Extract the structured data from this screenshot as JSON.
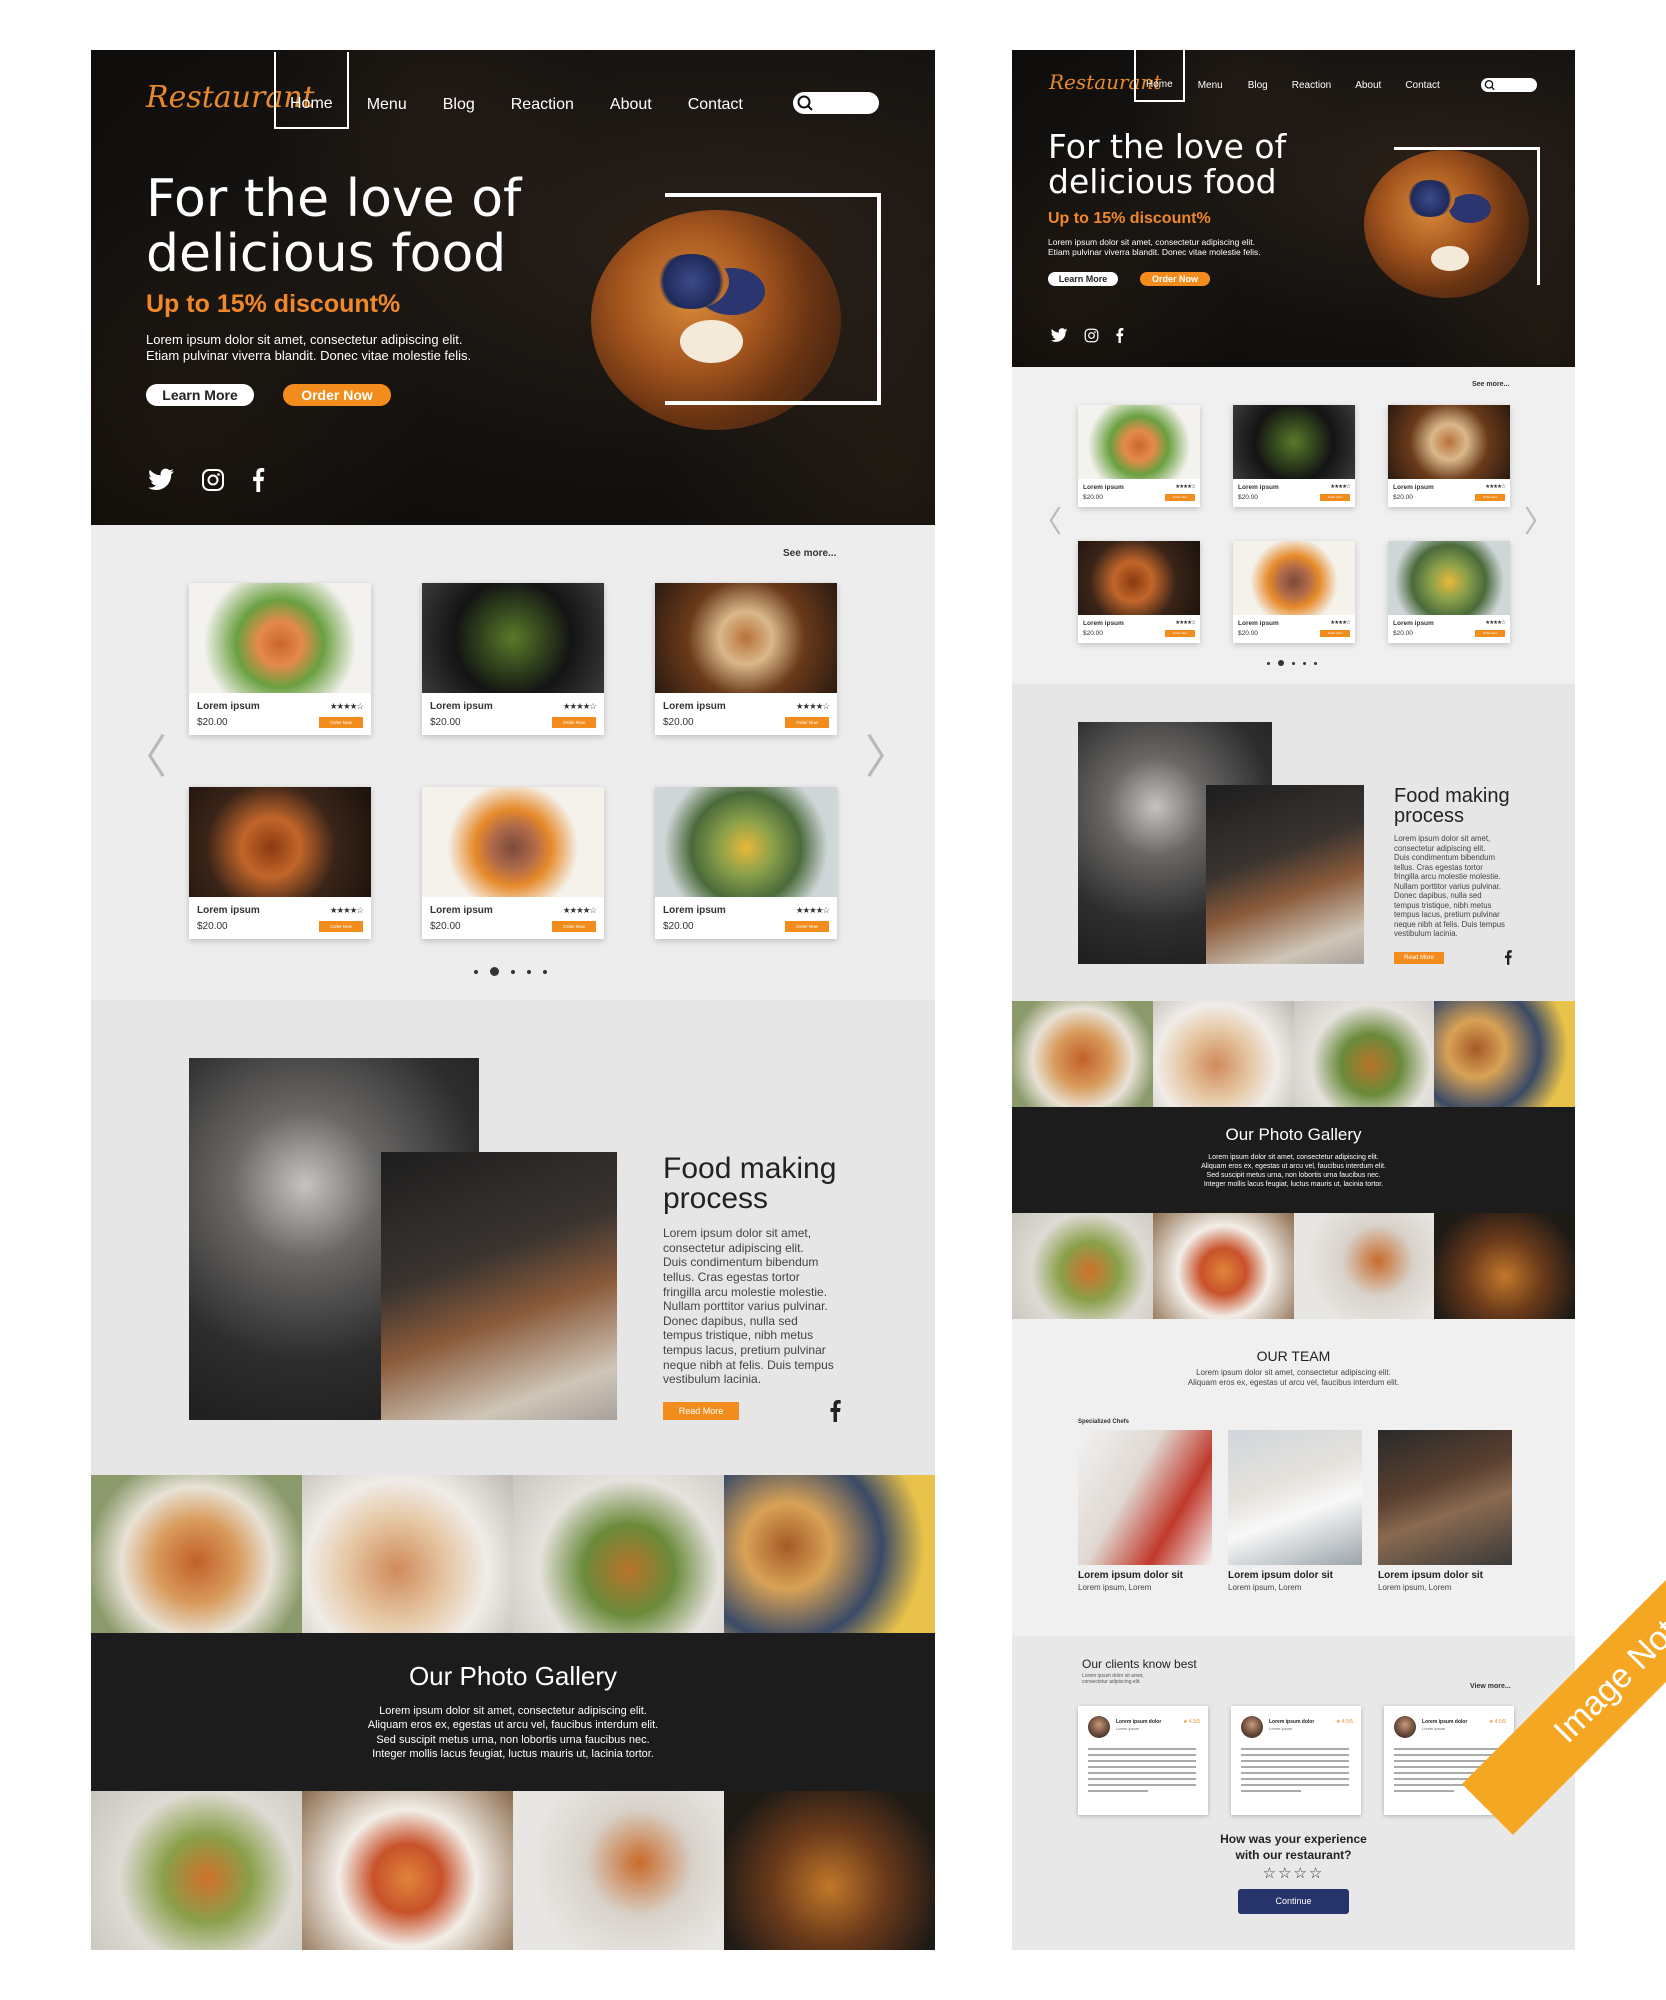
{
  "nav": {
    "logo": "Restaurant",
    "items": [
      "Home",
      "Menu",
      "Blog",
      "Reaction",
      "About",
      "Contact"
    ]
  },
  "hero": {
    "title": "For the love of\ndelicious food",
    "discount": "Up to 15% discount%",
    "text": "Lorem ipsum dolor sit amet, consectetur adipiscing elit.\nEtiam pulvinar viverra blandit. Donec vitae molestie felis.",
    "learn_more": "Learn More",
    "order_now": "Order Now"
  },
  "menu": {
    "see_more": "See more...",
    "card_name": "Lorem ipsum",
    "card_price": "$20.00",
    "card_stars": "★★★★☆",
    "card_btn": "Order Now",
    "cards": [
      {
        "photo": "salmon-salad"
      },
      {
        "photo": "noodle-bowl"
      },
      {
        "photo": "sandwich"
      },
      {
        "photo": "roast-chicken"
      },
      {
        "photo": "lamb-chops"
      },
      {
        "photo": "egg-salad"
      }
    ],
    "arrow_left": "〈",
    "arrow_right": "〉"
  },
  "food_making": {
    "title": "Food making\nprocess",
    "text": "Lorem ipsum dolor sit amet,\nconsectetur adipiscing elit.\nDuis condimentum bibendum\ntellus. Cras egestas tortor\nfringilla arcu molestie molestie.\nNullam porttitor varius pulvinar.\nDonec dapibus, nulla sed\ntempus tristique, nibh metus\ntempus lacus, pretium pulvinar\nneque nibh at felis. Duis tempus\nvestibulum lacinia.",
    "read_more": "Read More"
  },
  "gallery": {
    "title": "Our Photo Gallery",
    "text": "Lorem ipsum dolor sit amet, consectetur adipiscing elit.\nAliquam eros ex, egestas ut arcu vel, faucibus interdum elit.\nSed suscipit metus urna, non lobortis urna faucibus nec.\nInteger mollis lacus feugiat, luctus mauris ut, lacinia tortor."
  },
  "team": {
    "title": "OUR TEAM",
    "text": "Lorem ipsum dolor sit amet, consectetur adipiscing elit.\nAliquam eros ex, egestas ut arcu vel, faucibus interdum elit.",
    "label": "Specialized Chefs",
    "chef_name": "Lorem ipsum dolor sit",
    "chef_role": "Lorem ipsum, Lorem"
  },
  "clients": {
    "title": "Our clients know best",
    "sub": "Lorem ipsum dolor sit amet,\nconsectetur adipiscing elit.",
    "view_more": "View more...",
    "reviewer": "Lorem ipsum dolor",
    "reviewer_sub": "Lorem ipsum",
    "rating": "★ 4.5/5",
    "question": "How was your experience\nwith our restaurant?",
    "stars": "☆☆☆☆",
    "continue": "Continue"
  },
  "badge": "Image Not Included",
  "colors": {
    "accent": "#f28c1c",
    "dark": "#141210",
    "button_blue": "#27346b"
  }
}
